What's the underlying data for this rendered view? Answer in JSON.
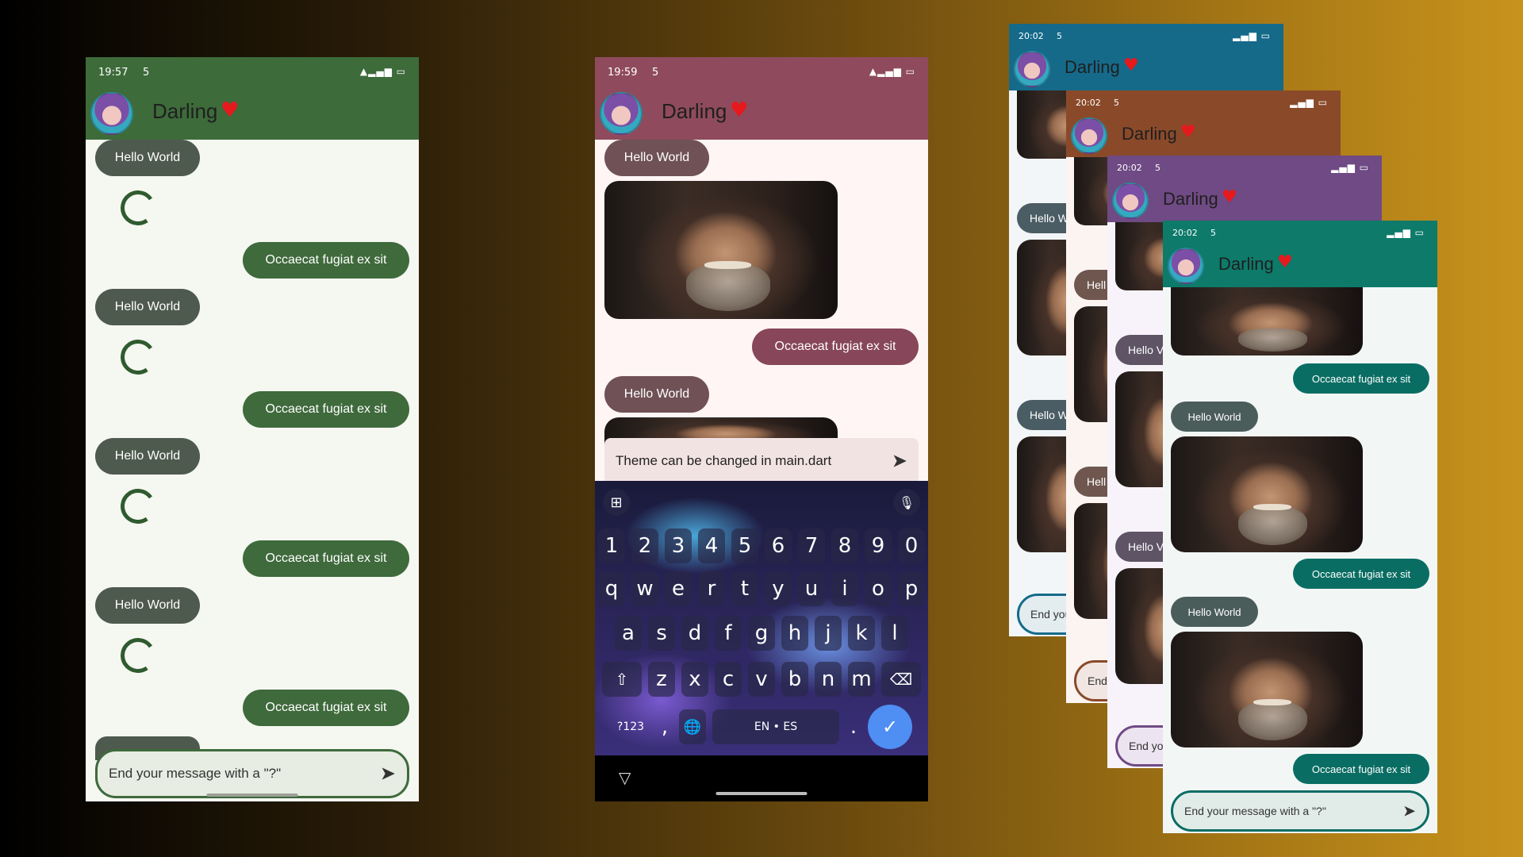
{
  "phones": {
    "green": {
      "time": "19:57",
      "status_suffix": "5",
      "status_icons": "📶▮",
      "title": "Darling",
      "heart": "♥",
      "messages": {
        "in_label": "Hello World",
        "out_label": "Occaecat fugiat ex sit"
      },
      "input_placeholder": "End your message with a \"?\"",
      "send_icon": "➤",
      "colors": {
        "appbar": "#3d6b3a",
        "bg": "#f5f7f1",
        "in": "#4e5a4d",
        "out": "#3f6a3c"
      }
    },
    "mauve": {
      "time": "19:59",
      "status_suffix": "5",
      "status_icons": "📶▮",
      "title": "Darling",
      "heart": "♥",
      "messages": {
        "in_label": "Hello World",
        "out_label": "Occaecat fugiat ex sit"
      },
      "input_text": "Theme can be changed in main.dart",
      "send_icon": "➤",
      "keyboard": {
        "row_numbers": [
          "1",
          "2",
          "3",
          "4",
          "5",
          "6",
          "7",
          "8",
          "9",
          "0"
        ],
        "row_1": [
          "q",
          "w",
          "e",
          "r",
          "t",
          "y",
          "u",
          "i",
          "o",
          "p"
        ],
        "row_2": [
          "a",
          "s",
          "d",
          "f",
          "g",
          "h",
          "j",
          "k",
          "l"
        ],
        "row_3": [
          "z",
          "x",
          "c",
          "v",
          "b",
          "n",
          "m"
        ],
        "symbols_key": "?123",
        "space_label": "EN • ES",
        "period_key": ".",
        "comma_key": ",",
        "shift_icon": "⇧",
        "backspace_icon": "⌫",
        "enter_icon": "✓",
        "globe_icon": "🌐",
        "apps_icon": "⊞",
        "mic_icon": "🎙"
      },
      "nav_back_icon": "▽",
      "colors": {
        "appbar": "#8f4b5d",
        "bg": "#fff5f5",
        "in": "#6f5156",
        "out": "#87465a"
      }
    },
    "stack": [
      {
        "time": "20:02",
        "status_suffix": "5",
        "title": "Darling",
        "heart": "♥",
        "in_short": "Hello W",
        "input_short": "End you",
        "color": "#156a8a"
      },
      {
        "time": "20:02",
        "status_suffix": "5",
        "title": "Darling",
        "heart": "♥",
        "in_short": "Hell",
        "input_short": "End",
        "color": "#8a4a2a"
      },
      {
        "time": "20:02",
        "status_suffix": "5",
        "title": "Darling",
        "heart": "♥",
        "in_short": "Hello V",
        "input_short": "End yo",
        "color": "#6f4a84"
      }
    ],
    "teal": {
      "time": "20:02",
      "status_suffix": "5",
      "title": "Darling",
      "heart": "♥",
      "messages": {
        "in_label": "Hello World",
        "out_label": "Occaecat fugiat ex sit"
      },
      "input_placeholder": "End your message with a \"?\"",
      "send_icon": "➤",
      "colors": {
        "appbar": "#0d7a6a",
        "bg": "#f2f7f6",
        "in": "#4b5d5b",
        "out": "#0a6d63"
      }
    }
  }
}
